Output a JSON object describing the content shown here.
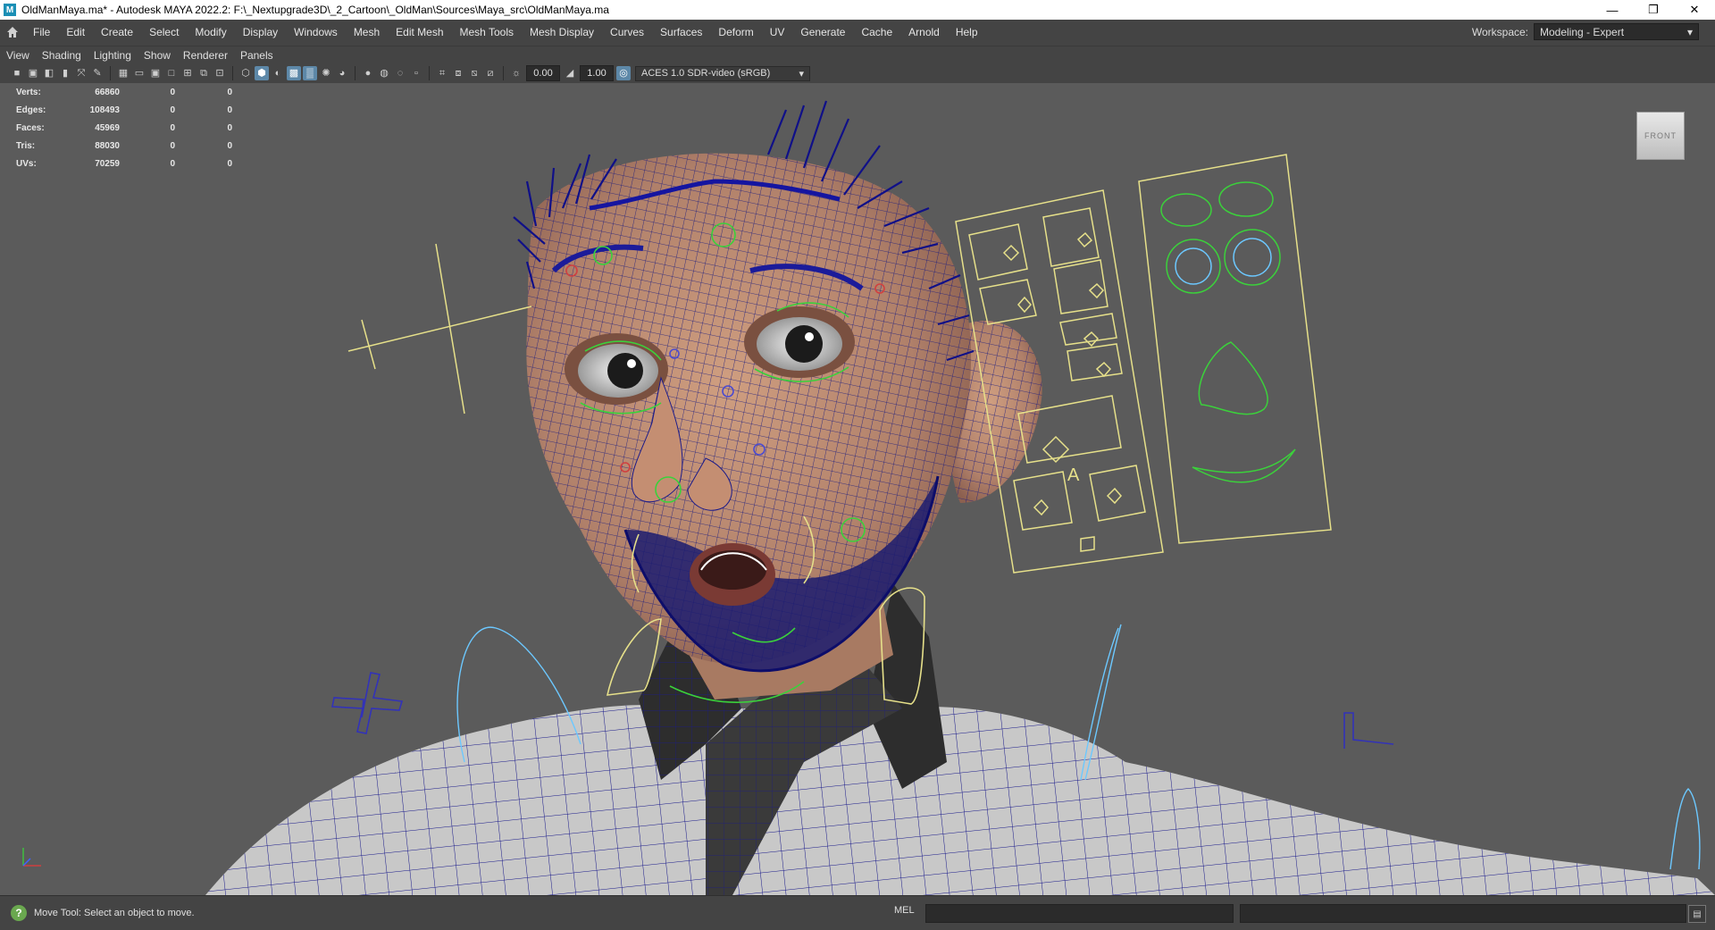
{
  "window": {
    "title": "OldManMaya.ma* - Autodesk MAYA 2022.2: F:\\_Nextupgrade3D\\_2_Cartoon\\_OldMan\\Sources\\Maya_src\\OldManMaya.ma",
    "app_icon": "M",
    "controls": {
      "minimize": "—",
      "restore": "❐",
      "close": "✕"
    }
  },
  "menubar": {
    "items": [
      "File",
      "Edit",
      "Create",
      "Select",
      "Modify",
      "Display",
      "Windows",
      "Mesh",
      "Edit Mesh",
      "Mesh Tools",
      "Mesh Display",
      "Curves",
      "Surfaces",
      "Deform",
      "UV",
      "Generate",
      "Cache",
      "Arnold",
      "Help"
    ],
    "workspace_label": "Workspace:",
    "workspace_value": "Modeling - Expert"
  },
  "panel_menu": {
    "items": [
      "View",
      "Shading",
      "Lighting",
      "Show",
      "Renderer",
      "Panels"
    ]
  },
  "viewport_toolbar": {
    "exposure": "0.00",
    "gamma": "1.00",
    "color_space": "ACES 1.0 SDR-video (sRGB)"
  },
  "hud": {
    "rows": [
      {
        "label": "Verts:",
        "v1": "66860",
        "v2": "0",
        "v3": "0"
      },
      {
        "label": "Edges:",
        "v1": "108493",
        "v2": "0",
        "v3": "0"
      },
      {
        "label": "Faces:",
        "v1": "45969",
        "v2": "0",
        "v3": "0"
      },
      {
        "label": "Tris:",
        "v1": "88030",
        "v2": "0",
        "v3": "0"
      },
      {
        "label": "UVs:",
        "v1": "70259",
        "v2": "0",
        "v3": "0"
      }
    ]
  },
  "viewcube": {
    "label": "FRONT"
  },
  "rig_ui": {
    "jaw_label": "A"
  },
  "helpline": {
    "text": "Move Tool: Select an object to move.",
    "script_lang": "MEL"
  },
  "colors": {
    "viewport_bg": "#5b5b5b",
    "wireframe": "#1a1a8a",
    "skin": "#b88a6e",
    "rig_yellow": "#e6e08a",
    "rig_green": "#3bd13b",
    "rig_cyan": "#6cc8ff"
  }
}
